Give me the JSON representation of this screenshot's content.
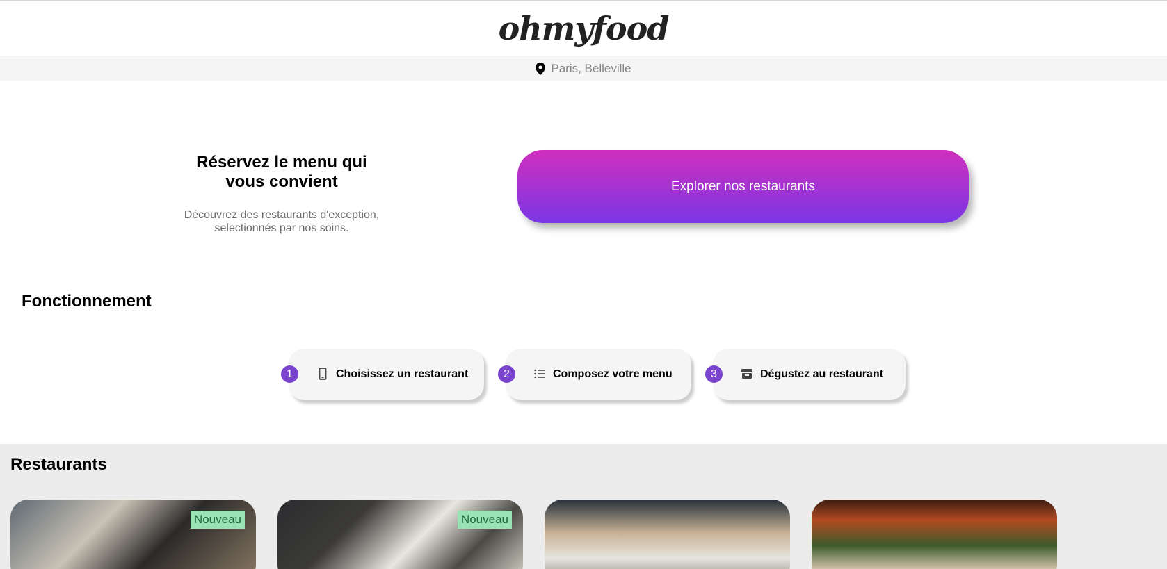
{
  "header": {
    "logo": "ohmyfood"
  },
  "location": {
    "text": "Paris, Belleville"
  },
  "hero": {
    "title_line1": "Réservez le menu qui",
    "title_line2": "vous convient",
    "subtitle_line1": "Découvrez des restaurants d'exception,",
    "subtitle_line2": "selectionnés par nos soins.",
    "cta_label": "Explorer nos restaurants"
  },
  "how_it_works": {
    "title": "Fonctionnement",
    "steps": [
      {
        "number": "1",
        "icon": "mobile-phone-icon",
        "label": "Choisissez un restaurant"
      },
      {
        "number": "2",
        "icon": "list-icon",
        "label": "Composez votre menu"
      },
      {
        "number": "3",
        "icon": "store-icon",
        "label": "Dégustez au restaurant"
      }
    ]
  },
  "restaurants": {
    "title": "Restaurants",
    "cards": [
      {
        "badge": "Nouveau"
      },
      {
        "badge": "Nouveau"
      },
      {
        "badge": ""
      },
      {
        "badge": ""
      }
    ]
  },
  "colors": {
    "accent_gradient_top": "#d02fbd",
    "accent_gradient_bottom": "#7b36e6",
    "step_number_bg": "#7b44cf",
    "badge_bg": "#99e2b4"
  }
}
